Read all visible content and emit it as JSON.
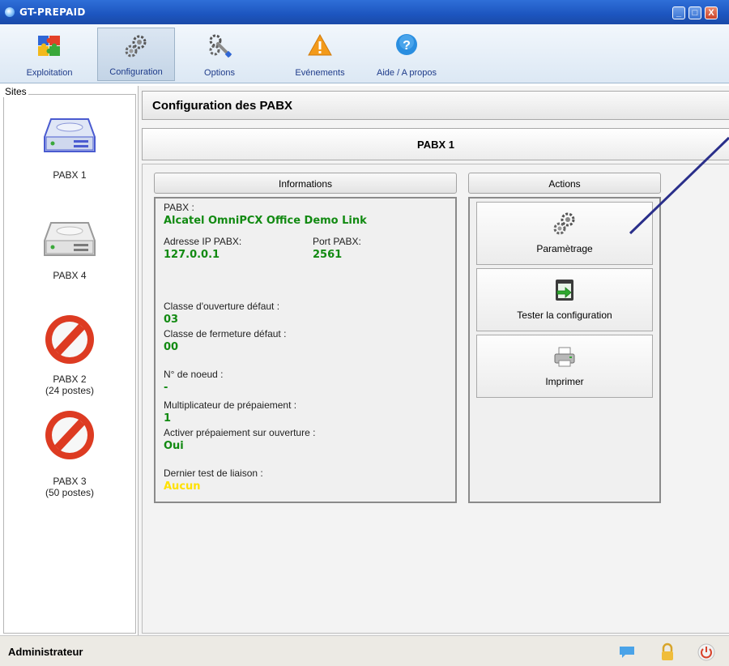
{
  "window": {
    "title": "GT-PREPAID",
    "buttons": [
      "_",
      "□",
      "X"
    ]
  },
  "toolbar": {
    "items": [
      {
        "label": "Exploitation",
        "icon": "puzzle-icon"
      },
      {
        "label": "Configuration",
        "icon": "gears-icon",
        "active": true
      },
      {
        "label": "Options",
        "icon": "tools-icon"
      },
      {
        "label": "Evénements",
        "icon": "warning-icon"
      },
      {
        "label": "Aide / A propos",
        "icon": "help-icon"
      }
    ]
  },
  "sites": {
    "legend": "Sites",
    "items": [
      {
        "label": "PABX 1",
        "icon": "server-selected-icon"
      },
      {
        "label": "PABX 4",
        "icon": "server-icon"
      },
      {
        "label": "PABX 2\n(24 postes)",
        "icon": "disabled-icon"
      },
      {
        "label": "PABX 3\n(50 postes)",
        "icon": "disabled-icon"
      }
    ]
  },
  "main": {
    "header": "Configuration des PABX",
    "pabx_title": "PABX 1",
    "informations": {
      "title": "Informations",
      "pabx_label": "PABX :",
      "pabx_value": "Alcatel OmniPCX Office Demo Link",
      "ip_label": "Adresse IP PABX:",
      "ip_value": "127.0.0.1",
      "port_label": "Port PABX:",
      "port_value": "2561",
      "ouverture_label": "Classe d'ouverture défaut :",
      "ouverture_value": "03",
      "fermeture_label": "Classe de fermeture défaut :",
      "fermeture_value": "00",
      "noeud_label": "N° de noeud :",
      "noeud_value": "-",
      "multiplicateur_label": "Multiplicateur de prépaiement :",
      "multiplicateur_value": "1",
      "activer_label": "Activer prépaiement sur ouverture :",
      "activer_value": "Oui",
      "dernier_label": "Dernier test de liaison :",
      "dernier_value": "Aucun"
    },
    "actions": {
      "title": "Actions",
      "buttons": [
        {
          "label": "Paramètrage",
          "icon": "gears-icon"
        },
        {
          "label": "Tester la configuration",
          "icon": "test-icon"
        },
        {
          "label": "Imprimer",
          "icon": "printer-icon"
        }
      ]
    }
  },
  "statusbar": {
    "user": "Administrateur",
    "icons": [
      "chat-icon",
      "lock-icon",
      "power-icon"
    ]
  },
  "colors": {
    "green_value": "#128a12",
    "yellow_value": "#ffe100",
    "arrow": "#2a2f8a"
  }
}
